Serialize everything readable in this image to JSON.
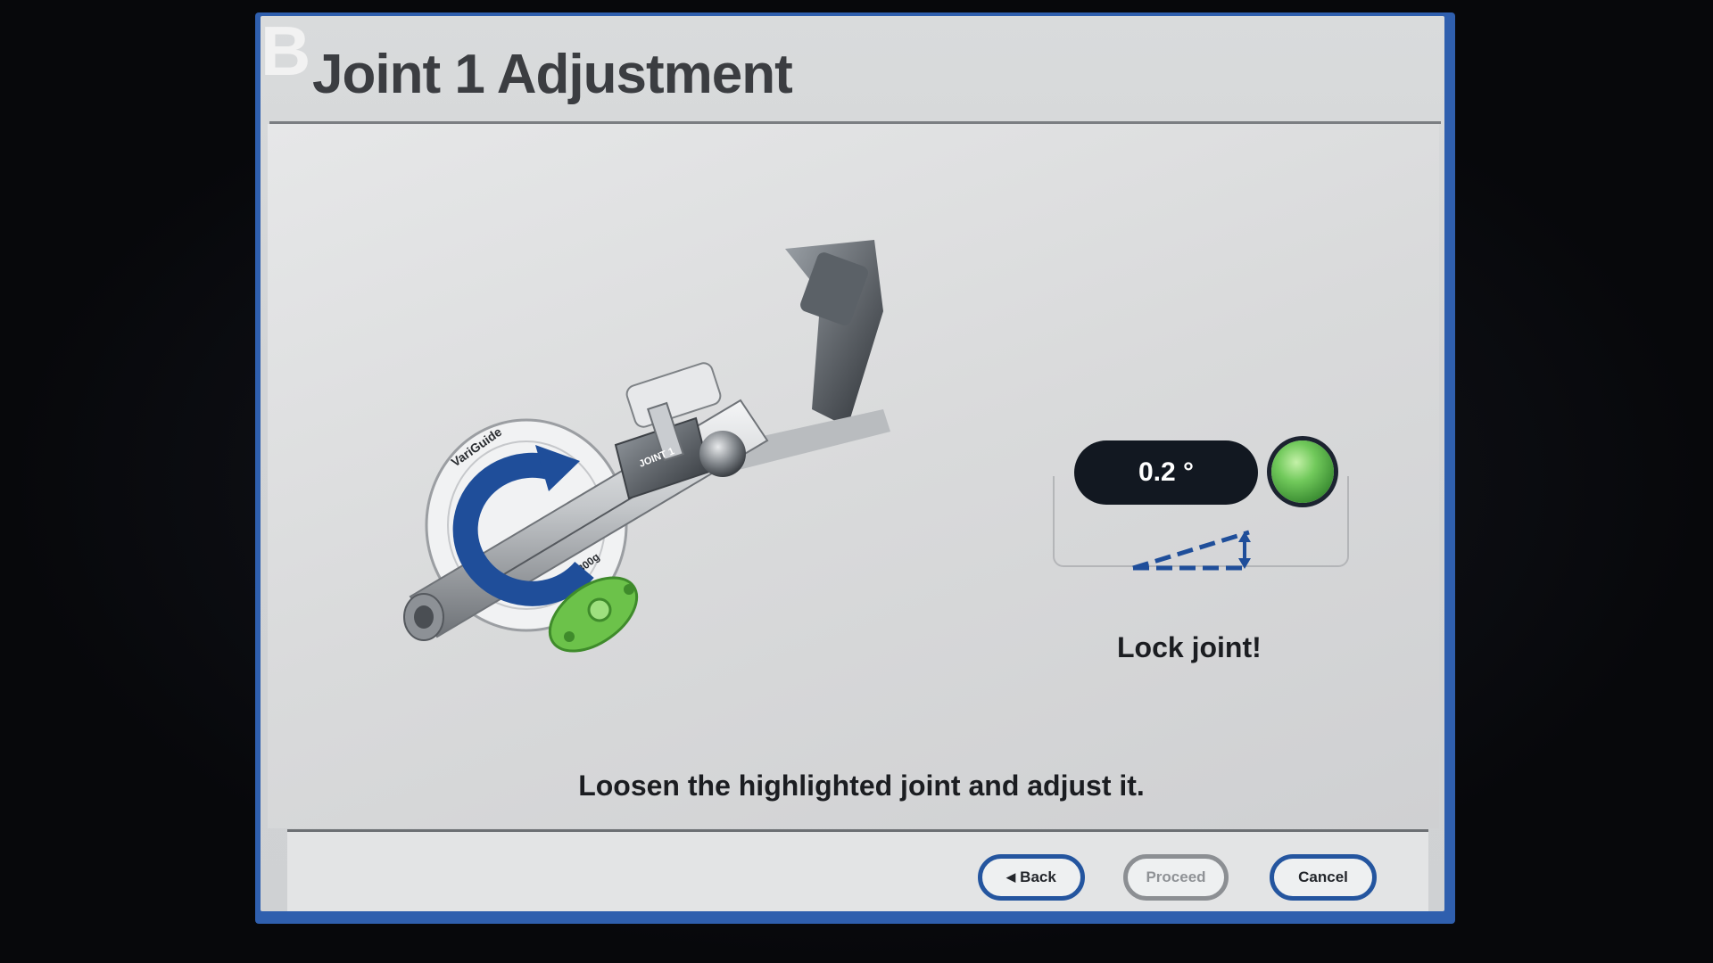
{
  "corner_label": "B",
  "title": "Joint 1 Adjustment",
  "readout": {
    "angle": "0.2 °",
    "status_color": "#5fbf4a"
  },
  "lock_label": "Lock joint!",
  "instruction": "Loosen the highlighted joint and adjust it.",
  "buttons": {
    "back": "Back",
    "back_icon": "triangle-left-icon",
    "proceed": "Proceed",
    "cancel": "Cancel"
  },
  "colors": {
    "accent_blue": "#24559f",
    "highlight_green": "#6cc24a",
    "rotation_arrow": "#1f4e9a"
  },
  "illustration": {
    "subject": "joint-adjustment-tool",
    "labels": [
      "VariGuide",
      "JOINT 1",
      "max. load 800g"
    ]
  }
}
